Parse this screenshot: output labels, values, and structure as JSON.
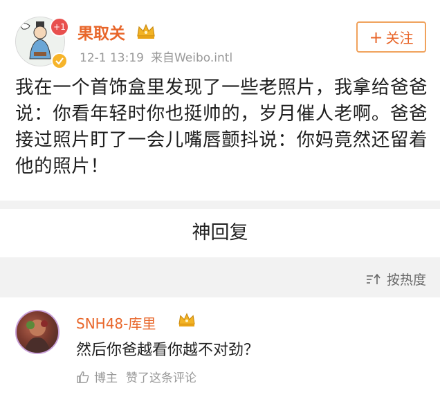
{
  "post": {
    "author": "果取关",
    "notif_count": "+1",
    "time": "12-1 13:19",
    "source": "来自Weibo.intl",
    "follow_label": "关注",
    "content": "我在一个首饰盒里发现了一些老照片，我拿给爸爸说：你看年轻时你也挺帅的，岁月催人老啊。爸爸接过照片盯了一会儿嘴唇颤抖说：你妈竟然还留着他的照片！"
  },
  "section": {
    "title": "神回复"
  },
  "sort": {
    "label": "按热度"
  },
  "comment": {
    "author": "SNH48-库里",
    "text": "然后你爸越看你越不对劲？",
    "author_tag": "博主",
    "liked_text": "赞了这条评论"
  },
  "colors": {
    "accent_orange": "#e8662a",
    "follow_border": "#f0a25c",
    "badge_red": "#e8504e",
    "crown_gold": "#f3b324",
    "meta_gray": "#999999",
    "divider_gray": "#f2f2f2"
  },
  "icons": [
    "avatar-illustration",
    "crown-icon",
    "verified-badge-icon",
    "plus-icon",
    "sort-icon",
    "thumbs-up-icon"
  ]
}
